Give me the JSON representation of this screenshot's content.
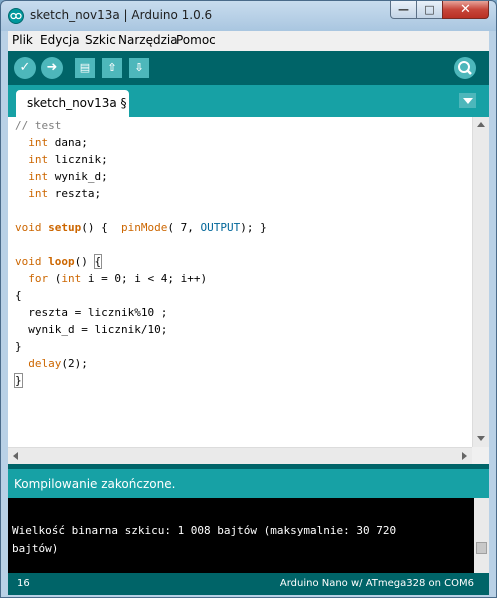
{
  "window": {
    "title": "sketch_nov13a | Arduino 1.0.6"
  },
  "menu": [
    "Plik",
    "Edycja",
    "Szkic",
    "Narzędzia",
    "Pomoc"
  ],
  "toolbar": {
    "buttons": [
      "verify-icon",
      "upload-icon",
      "new-icon",
      "open-icon",
      "save-icon"
    ],
    "serial_monitor": "magnifier-icon"
  },
  "tab": {
    "label": "sketch_nov13a §"
  },
  "code": {
    "l1": "// test",
    "l2": "int",
    "l2b": " dana;",
    "l3": "int",
    "l3b": " licznik;",
    "l4": "int",
    "l4b": " wynik_d;",
    "l5": "int",
    "l5b": " reszta;",
    "l7a": "void",
    "l7b": "setup",
    "l7c": "() {  ",
    "l7d": "pinMode",
    "l7e": "( 7, ",
    "l7f": "OUTPUT",
    "l7g": "); }",
    "l9a": "void",
    "l9b": "loop",
    "l9c": "() ",
    "l9d": "{",
    "l10a": "for",
    "l10b": " (",
    "l10c": "int",
    "l10d": " i = 0; i < 4; i++)",
    "l11": "{",
    "l12": "  reszta = licznik%10 ;",
    "l13": "  wynik_d = licznik/10;",
    "l14": "}",
    "l15a": "delay",
    "l15b": "(2);",
    "l16": "}"
  },
  "status": {
    "message": "Kompilowanie zakończone."
  },
  "console": {
    "output": "Wielkość binarna szkicu: 1 008 bajtów (maksymalnie: 30 720\nbajtów)"
  },
  "footer": {
    "line_number": "16",
    "board": "Arduino Nano w/ ATmega328 on COM6"
  },
  "colors": {
    "toolbar": "#006468",
    "tabbar": "#17a1a5",
    "accent": "#4db7bb",
    "console": "#000000"
  }
}
